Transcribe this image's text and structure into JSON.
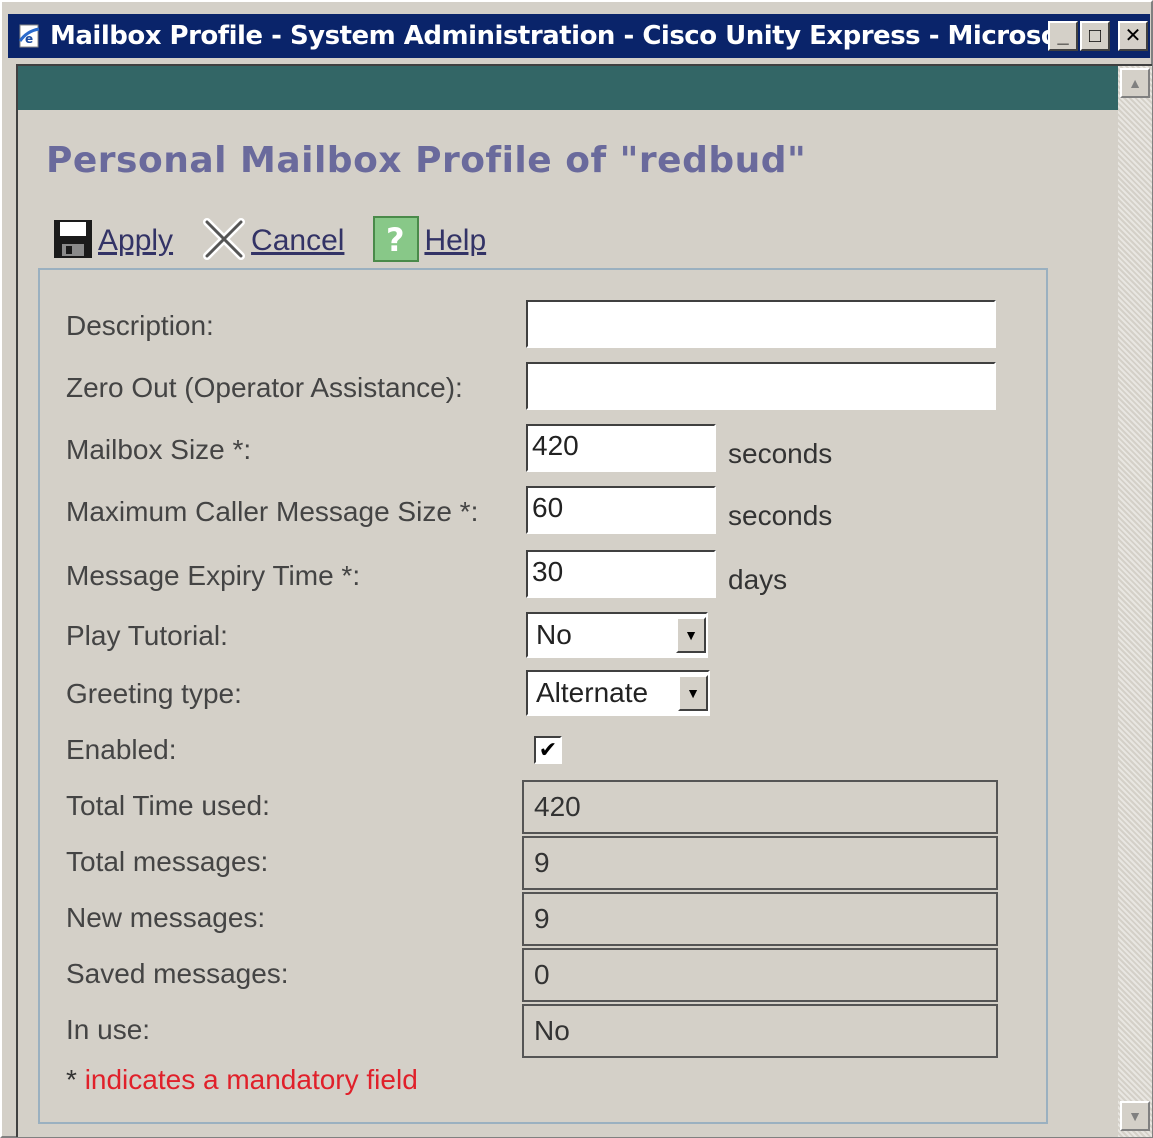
{
  "window": {
    "title": "Mailbox Profile - System Administration - Cisco Unity Express - Microsoft ...",
    "minimize": "_",
    "maximize": "□",
    "close": "✕"
  },
  "page": {
    "title": "Personal Mailbox Profile of \"redbud\""
  },
  "toolbar": {
    "apply": "Apply",
    "cancel": "Cancel",
    "help": "Help"
  },
  "form": {
    "description": {
      "label": "Description:",
      "value": ""
    },
    "zero_out": {
      "label": "Zero Out (Operator Assistance):",
      "value": ""
    },
    "mailbox_size": {
      "label": "Mailbox Size *:",
      "value": "420",
      "unit": "seconds"
    },
    "max_msg_size": {
      "label": "Maximum Caller Message Size *:",
      "value": "60",
      "unit": "seconds"
    },
    "expiry": {
      "label": "Message Expiry Time *:",
      "value": "30",
      "unit": "days"
    },
    "tutorial": {
      "label": "Play Tutorial:",
      "value": "No"
    },
    "greeting": {
      "label": "Greeting type:",
      "value": "Alternate"
    },
    "enabled": {
      "label": "Enabled:",
      "checked": "✔"
    },
    "total_time": {
      "label": "Total Time used:",
      "value": "420"
    },
    "total_messages": {
      "label": "Total messages:",
      "value": "9"
    },
    "new_messages": {
      "label": "New messages:",
      "value": "9"
    },
    "saved_messages": {
      "label": "Saved messages:",
      "value": "0"
    },
    "in_use": {
      "label": "In use:",
      "value": "No"
    }
  },
  "footnote": {
    "star": "*",
    "text": "indicates a mandatory field"
  },
  "colors": {
    "title_bar": "#0a246a",
    "teal_bar": "#336666",
    "mandatory": "#e0202a"
  },
  "icons": [
    "ie-page-icon",
    "floppy-disk-icon",
    "x-cancel-icon",
    "question-help-icon",
    "dropdown-arrow-icon",
    "scroll-up-icon",
    "scroll-down-icon"
  ]
}
